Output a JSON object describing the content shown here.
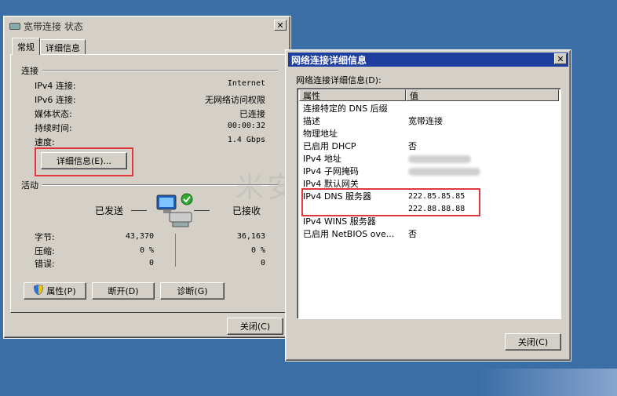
{
  "status_window": {
    "title": "宽带连接 状态",
    "tabs": [
      {
        "label": "常规"
      },
      {
        "label": "详细信息"
      }
    ],
    "connection": {
      "section": "连接",
      "rows": [
        {
          "label": "IPv4 连接:",
          "value": "Internet"
        },
        {
          "label": "IPv6 连接:",
          "value": "无网络访问权限"
        },
        {
          "label": "媒体状态:",
          "value": "已连接"
        },
        {
          "label": "持续时间:",
          "value": "00:00:32"
        },
        {
          "label": "速度:",
          "value": "1.4 Gbps"
        }
      ],
      "details_button": "详细信息(E)..."
    },
    "activity": {
      "section": "活动",
      "sent_label": "已发送",
      "received_label": "已接收",
      "rows": [
        {
          "label": "字节:",
          "sent": "43,370",
          "received": "36,163"
        },
        {
          "label": "压缩:",
          "sent": "0 %",
          "received": "0 %"
        },
        {
          "label": "错误:",
          "sent": "0",
          "received": "0"
        }
      ]
    },
    "buttons": {
      "properties": "属性(P)",
      "disconnect": "断开(D)",
      "diagnose": "诊断(G)",
      "close": "关闭(C)"
    }
  },
  "details_window": {
    "title": "网络连接详细信息",
    "list_label": "网络连接详细信息(D):",
    "columns": {
      "property": "属性",
      "value": "值"
    },
    "rows": [
      {
        "key": "连接特定的 DNS 后缀",
        "value": ""
      },
      {
        "key": "描述",
        "value": "宽带连接"
      },
      {
        "key": "物理地址",
        "value": ""
      },
      {
        "key": "已启用 DHCP",
        "value": "否"
      },
      {
        "key": "IPv4 地址",
        "value": ""
      },
      {
        "key": "IPv4 子网掩码",
        "value": ""
      },
      {
        "key": "IPv4 默认网关",
        "value": ""
      },
      {
        "key": "IPv4 DNS 服务器",
        "value": "222.85.85.85"
      },
      {
        "key": "",
        "value": "222.88.88.88"
      },
      {
        "key": "IPv4 WINS 服务器",
        "value": ""
      },
      {
        "key": "已启用 NetBIOS ove...",
        "value": "否"
      }
    ],
    "close_button": "关闭(C)"
  },
  "watermark": "米安网络",
  "colors": {
    "desktop": "#3a6ea5",
    "titlebar_active": "#1f3fa0",
    "highlight": "#e0383e"
  },
  "icons": {
    "network": "network-computers-icon",
    "shield": "uac-shield-icon",
    "app": "broadband-connection-icon"
  }
}
